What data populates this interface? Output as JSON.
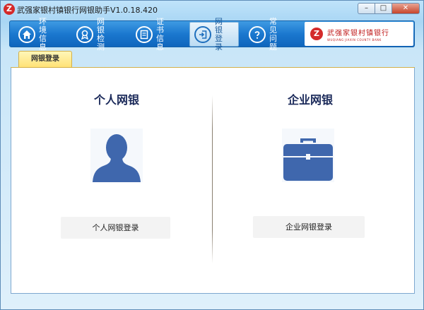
{
  "window": {
    "app_icon": "Z",
    "title": "武强家银村镇银行网银助手V1.0.18.420",
    "controls": {
      "minimize": "–",
      "maximize": "□",
      "close": "✕"
    }
  },
  "nav": {
    "items": [
      {
        "label": "环境信息",
        "icon": "home-icon"
      },
      {
        "label": "网银检测",
        "icon": "medal-icon"
      },
      {
        "label": "证书信息",
        "icon": "certificate-icon"
      },
      {
        "label": "网银登录",
        "icon": "login-icon",
        "active": true
      },
      {
        "label": "常见问题",
        "icon": "question-icon"
      }
    ]
  },
  "logo": {
    "mark": "Z",
    "cn": "武强家银村镇银行",
    "en": "WUQIANG JIAXIN COUNTY BANK"
  },
  "tab": {
    "label": "网银登录"
  },
  "personal": {
    "title": "个人网银",
    "icon": "person-icon",
    "button": "个人网银登录"
  },
  "corporate": {
    "title": "企业网银",
    "icon": "briefcase-icon",
    "button": "企业网银登录"
  },
  "colors": {
    "nav_blue": "#1b78cf",
    "tab_yellow": "#ffe173",
    "icon_blue": "#3f67ad",
    "title_navy": "#1b2a5a",
    "brand_red": "#d42a2a"
  }
}
